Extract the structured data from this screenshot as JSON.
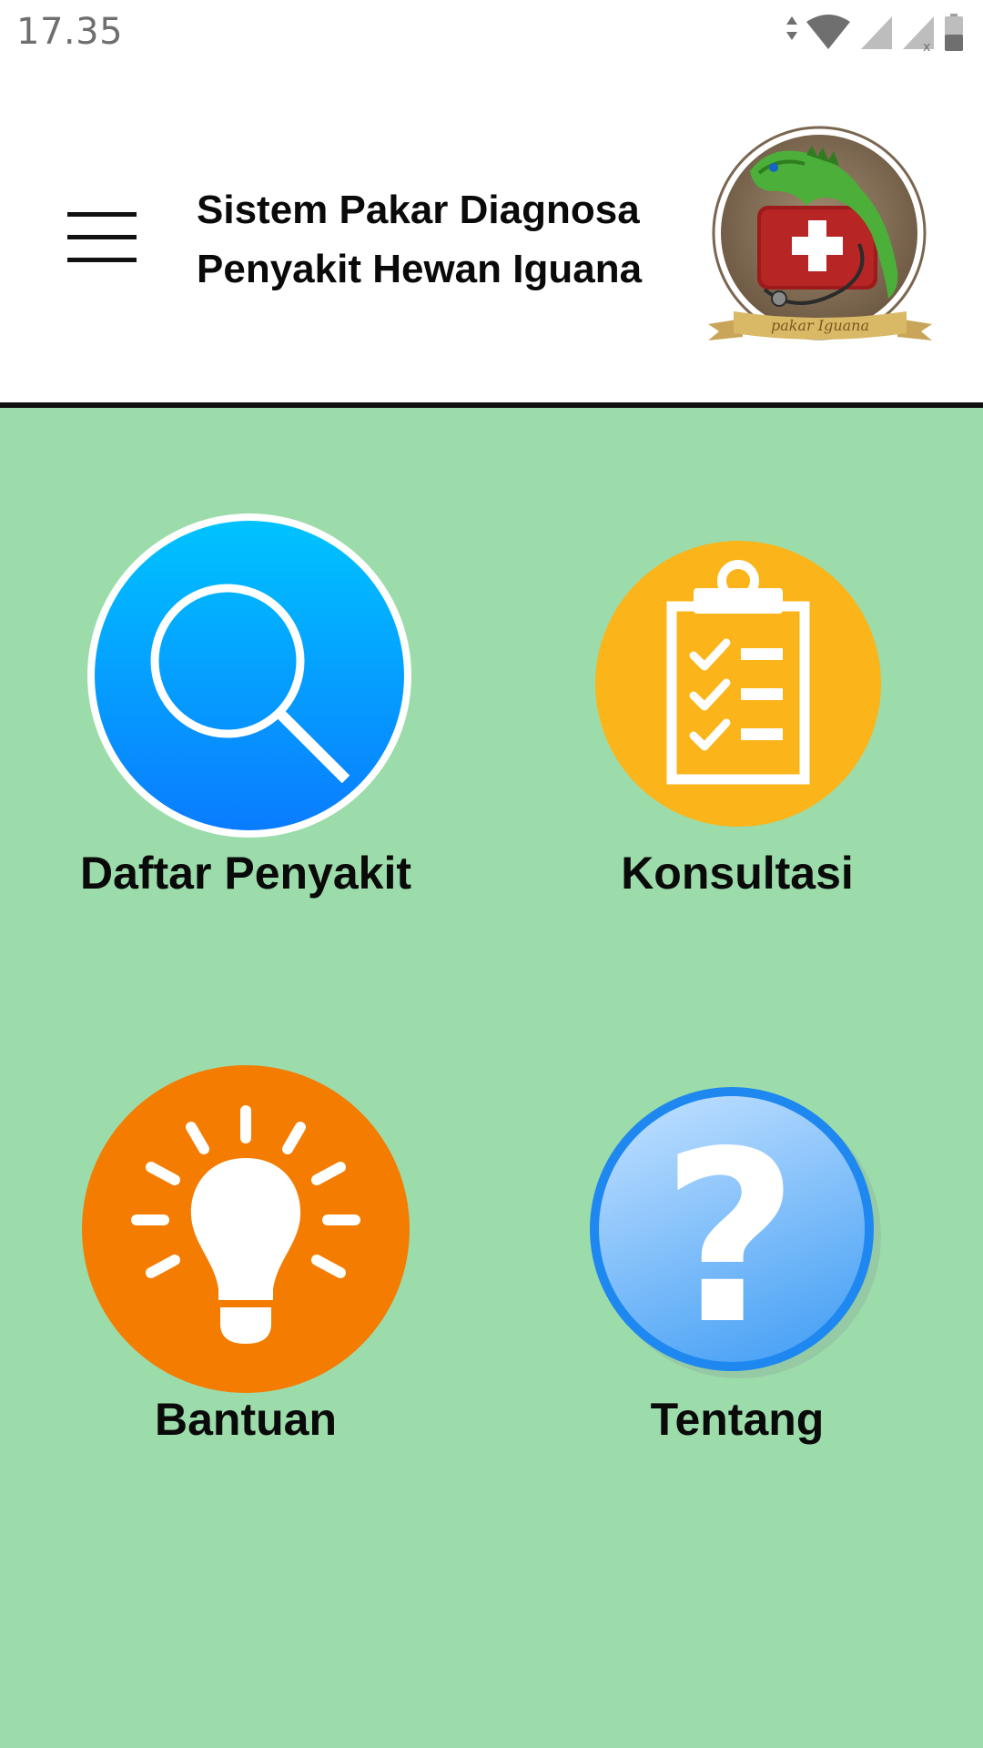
{
  "status_bar": {
    "time": "17.35",
    "icons": [
      "data-arrows-icon",
      "wifi-icon",
      "signal-icon",
      "signal-no-sim-icon",
      "battery-icon"
    ]
  },
  "header": {
    "title_line1": "Sistem Pakar Diagnosa",
    "title_line2": "Penyakit Hewan Iguana",
    "logo_text": "pakar Iguana",
    "menu_icon": "hamburger-menu-icon"
  },
  "colors": {
    "background": "#9cdcab",
    "search_blue": "#0a8cff",
    "clipboard_yellow": "#fbb419",
    "bulb_orange": "#f47c00",
    "help_blue": "#5aaaf5"
  },
  "menu": {
    "items": [
      {
        "label": "Daftar Penyakit",
        "icon": "search-icon"
      },
      {
        "label": "Konsultasi",
        "icon": "clipboard-checklist-icon"
      },
      {
        "label": "Bantuan",
        "icon": "lightbulb-icon"
      },
      {
        "label": "Tentang",
        "icon": "question-mark-icon"
      }
    ]
  }
}
